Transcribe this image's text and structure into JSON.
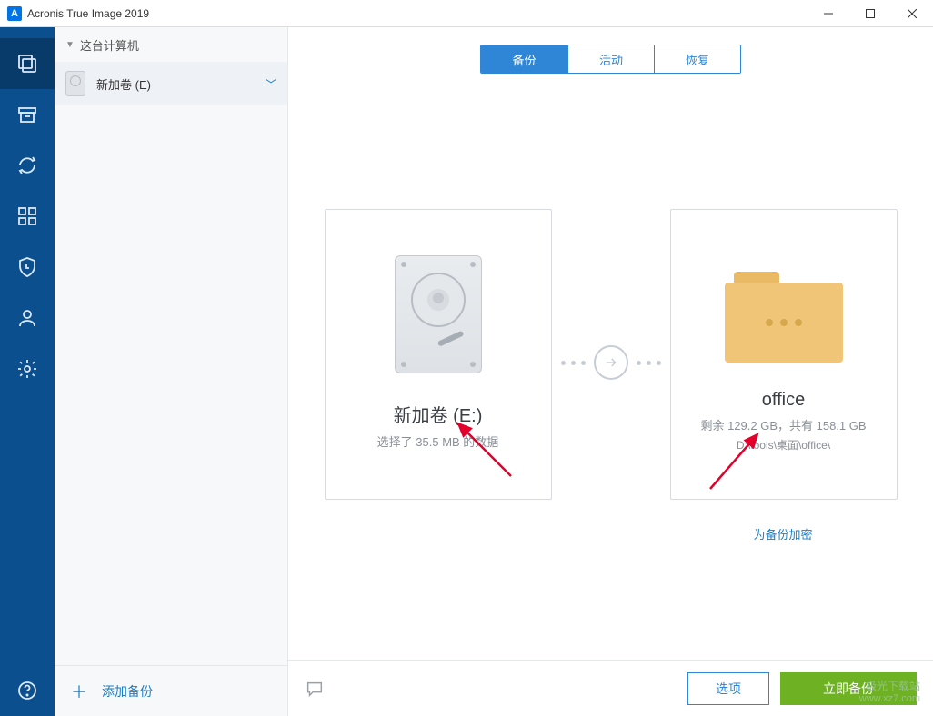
{
  "titlebar": {
    "title": "Acronis True Image 2019",
    "icon_letter": "A"
  },
  "nav": {
    "items": [
      {
        "name": "backup",
        "active": true
      },
      {
        "name": "archive",
        "active": false
      },
      {
        "name": "sync",
        "active": false
      },
      {
        "name": "tools",
        "active": false
      },
      {
        "name": "protection",
        "active": false
      },
      {
        "name": "account",
        "active": false
      },
      {
        "name": "settings",
        "active": false
      }
    ],
    "help": "help"
  },
  "listpanel": {
    "group_label": "这台计算机",
    "items": [
      {
        "label": "新加卷 (E)"
      }
    ],
    "add_label": "添加备份"
  },
  "tabs": {
    "items": [
      {
        "label": "备份",
        "active": true
      },
      {
        "label": "活动",
        "active": false
      },
      {
        "label": "恢复",
        "active": false
      }
    ]
  },
  "source_card": {
    "title": "新加卷 (E:)",
    "subtitle": "选择了 35.5 MB 的数据"
  },
  "dest_card": {
    "title": "office",
    "subtitle": "剩余 129.2 GB，共有 158.1 GB",
    "path": "D:\\tools\\桌面\\office\\"
  },
  "encrypt_link": "为备份加密",
  "bottombar": {
    "options_label": "选项",
    "backup_now_label": "立即备份"
  },
  "watermark": {
    "line1": "极光下载站",
    "line2": "www.xz7.com"
  }
}
